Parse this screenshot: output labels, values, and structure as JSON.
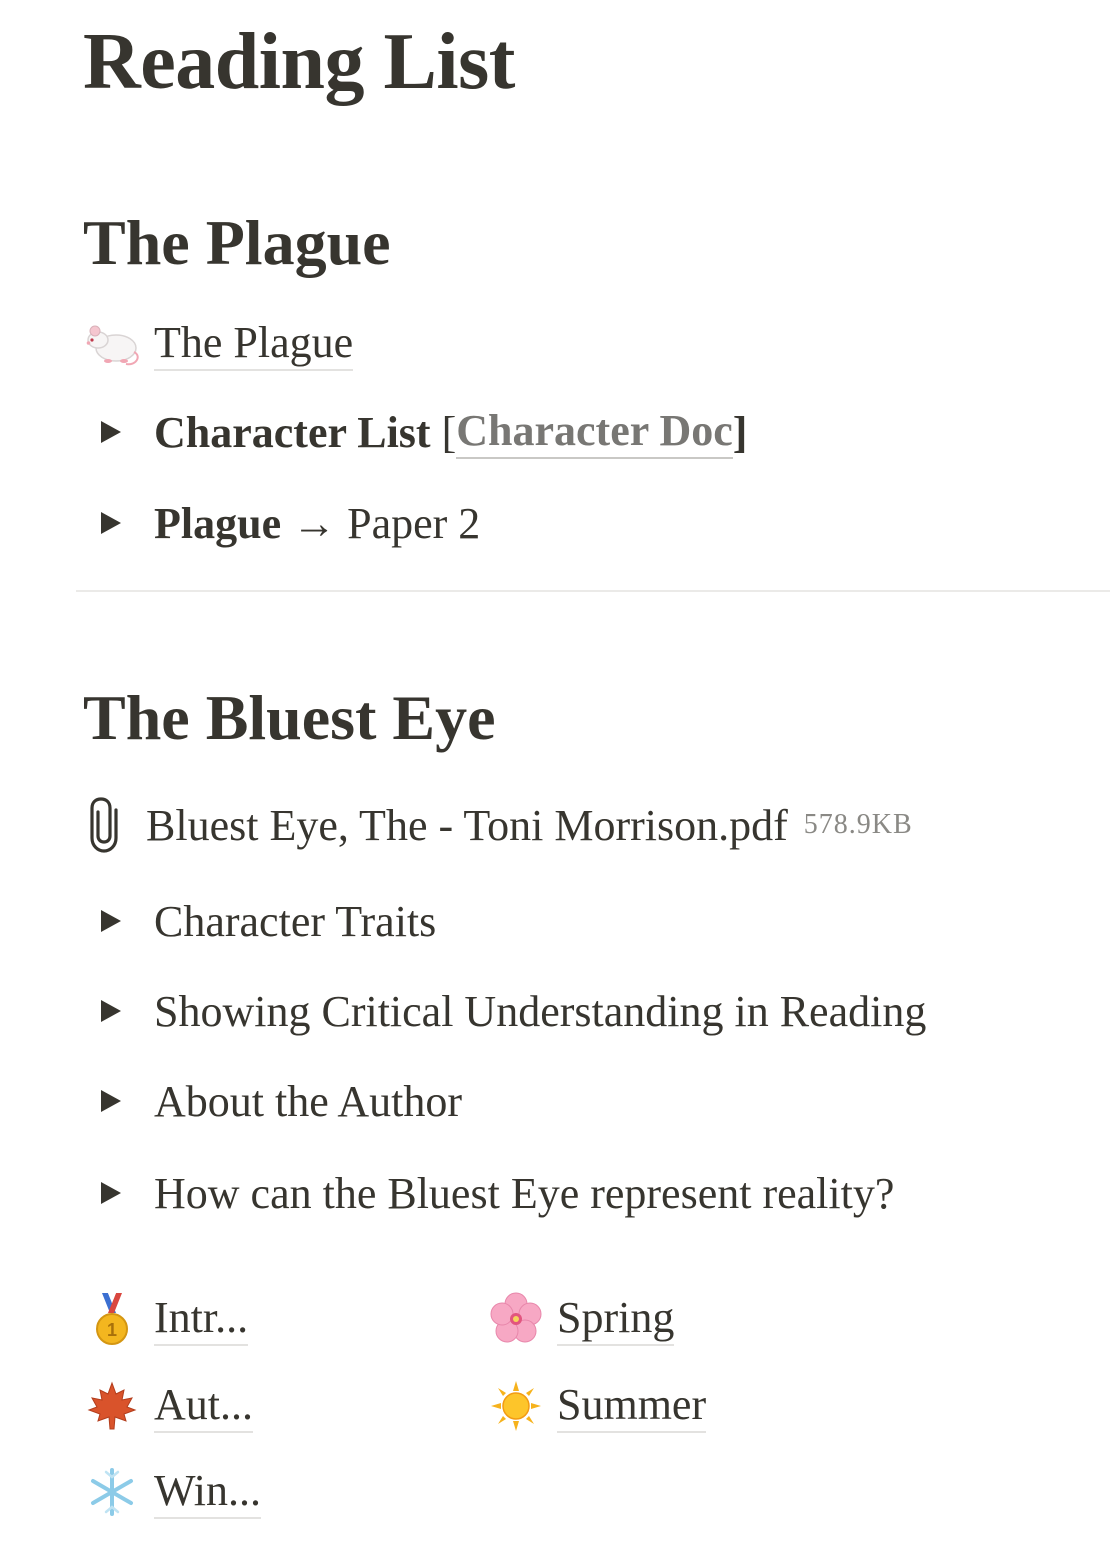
{
  "page": {
    "title": "Reading List"
  },
  "section_plague": {
    "heading": "The Plague",
    "page_link": {
      "icon": "rat-emoji",
      "label": "The Plague"
    },
    "toggles": [
      {
        "bold_label": "Character List",
        "bracket_open": " [",
        "link_label": "Character Doc",
        "bracket_close": "]"
      },
      {
        "bold_label": "Plague",
        "arrow": " → ",
        "rest": "Paper 2"
      }
    ]
  },
  "section_bluest": {
    "heading": "The Bluest Eye",
    "file": {
      "icon": "paperclip-icon",
      "name": "Bluest Eye, The - Toni Morrison.pdf",
      "size": "578.9KB"
    },
    "toggles": [
      {
        "label": "Character Traits"
      },
      {
        "label": "Showing Critical Understanding in Reading"
      },
      {
        "label": "About the Author"
      },
      {
        "label": "How can the Bluest Eye represent reality?"
      }
    ]
  },
  "grid_links": {
    "left": [
      {
        "icon": "medal-emoji",
        "label": "Intr..."
      },
      {
        "icon": "maple-leaf-emoji",
        "label": "Aut..."
      },
      {
        "icon": "snowflake-emoji",
        "label": "Win..."
      }
    ],
    "right": [
      {
        "icon": "cherry-blossom-emoji",
        "label": "Spring"
      },
      {
        "icon": "sun-emoji",
        "label": "Summer"
      }
    ]
  }
}
